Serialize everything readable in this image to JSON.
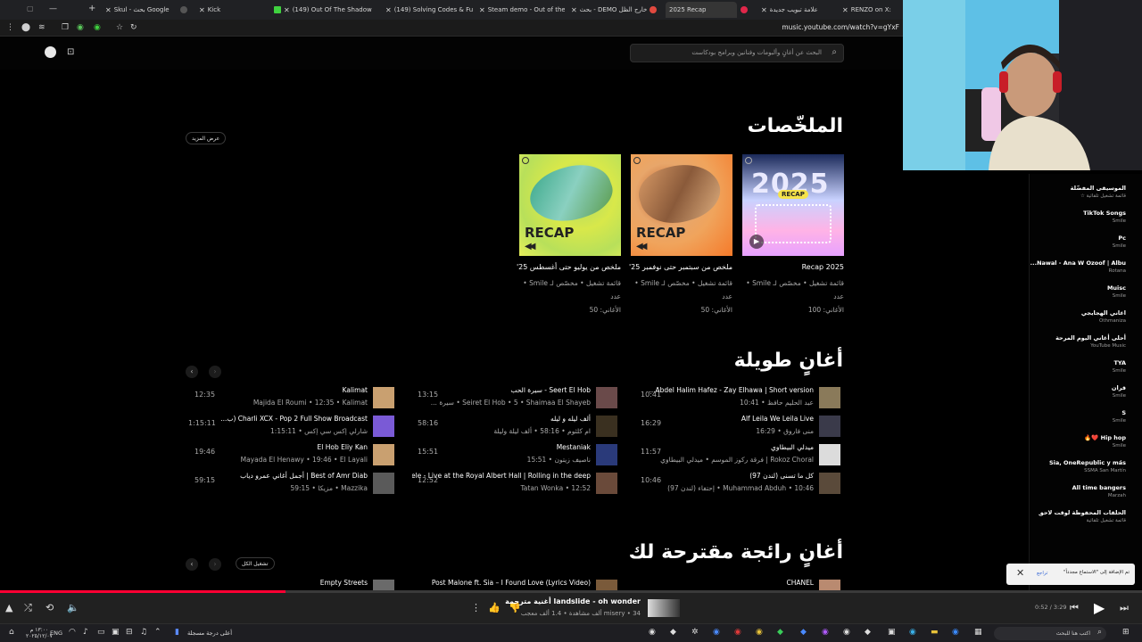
{
  "browser": {
    "tabs": [
      {
        "label": "Skul - بحث Google"
      },
      {
        "label": "Kick"
      },
      {
        "label": "(149) Out Of The Shadow"
      },
      {
        "label": "(149) Solving Codes & Fu"
      },
      {
        "label": "Steam demo - Out of the"
      },
      {
        "label": "بحث - DEMO خارج الظل"
      },
      {
        "label": "2025 Recap"
      },
      {
        "label": "علامة تبويب جديدة"
      },
      {
        "label": "RENZO on X: "
      }
    ],
    "url": "music.youtube.com/watch?v=gYxF"
  },
  "search": {
    "placeholder": "البحث عن أغانٍ وألبومات وفنانين وبرامج بودكاست"
  },
  "recap_section": {
    "heading": "الملخّصات",
    "more_label": "عرض المزيد",
    "cards": [
      {
        "title": "2025 Recap",
        "sub1": "قائمة تشغيل • مخصّص لـ Smile • عدد",
        "sub2": "الأغاني: 100",
        "badge": "2025",
        "badge2": "RECAP"
      },
      {
        "title": "ملخص من سبتمبر حتى نوفمبر 25'",
        "sub1": "قائمة تشغيل • مخصّص لـ Smile • عدد",
        "sub2": "الأغاني: 50",
        "word": "RECAP",
        "rewind": "◀◀"
      },
      {
        "title": "ملخص من يوليو حتى أغسطس 25'",
        "sub1": "قائمة تشغيل • مخصّص لـ Smile • عدد",
        "sub2": "الأغاني: 50",
        "word": "RECAP",
        "rewind": "◀◀"
      }
    ]
  },
  "long_section": {
    "heading": "أغانٍ طويلة",
    "songs": [
      {
        "title": "Abdel Halim Hafez - Zay Elhawa | Short version...",
        "sub": "عبد الحليم حافظ • 10:41",
        "dur": "10:41",
        "color": "#8a7a5a"
      },
      {
        "title": "Alf Leila We Leila Live",
        "sub": "منى فاروق • 16:29",
        "dur": "16:29",
        "color": "#3a3a4a"
      },
      {
        "title": "ميدلي البيطاوي",
        "sub": "Rokoz Choral | فرقة ركوز الموسم • ميدلي البيطاوي",
        "dur": "11:57",
        "color": "#dcdcdc"
      },
      {
        "title": "كل ما تسنى (لندن 97)",
        "sub": "Muhammad Abduh • 10:46 • إحتفاء (لندن 97)",
        "dur": "10:46",
        "color": "#5a4a3a"
      },
      {
        "title": "Seert El Hob - سيرة الحب",
        "sub": "Seiret El Hob • 5 • Shaimaa El Shayeb • سيرة ...",
        "dur": "13:15",
        "color": "#6a4a4a"
      },
      {
        "title": "ألف ليله و ليله",
        "sub": "ام كلثوم • 58:16 • ألف ليلة وليلة",
        "dur": "58:16",
        "color": "#3a3020"
      },
      {
        "title": "Mestaniak",
        "sub": "ناصيف زيتون • 15:51",
        "dur": "15:51",
        "color": "#2a3a7a"
      },
      {
        "title": "Adele - Live at the Royal Albert Hall | Rolling in the deep...",
        "sub": "Tatan Wonka • 12:52",
        "dur": "12:52",
        "color": "#6a4a3a"
      },
      {
        "title": "Kalimat",
        "sub": "Majida El Roumi • 12:35 • Kalimat",
        "dur": "12:35",
        "color": "#c9a070"
      },
      {
        "title": "Charli XCX - Pop 2 Full Show Broadcast (ب...",
        "sub": "شارلي إكس سي إكس • 1:15:11",
        "dur": "1:15:11",
        "color": "#7a5ad6"
      },
      {
        "title": "El Hob Eliy Kan",
        "sub": "Mayada El Henawy • 19:46 • El Layali",
        "dur": "19:46",
        "color": "#c9a070"
      },
      {
        "title": "Best of Amr Diab | أجمل أغاني عمرو دياب",
        "sub": "Mazzika • مزيكا • 59:15",
        "dur": "59:15",
        "color": "#5a5a5a"
      }
    ]
  },
  "trending_section": {
    "heading": "أغانٍ رائجة مقترحة لك",
    "play_all": "تشغيل الكل",
    "songs": [
      {
        "title": "CHANEL"
      },
      {
        "title": "Post Malone ft. Sia – I Found Love (Lyrics Video)"
      },
      {
        "title": "Empty Streets"
      }
    ]
  },
  "sidebar": {
    "items": [
      {
        "a": "الموسيقى المفضّلة",
        "b": "قائمة تشغيل تلقائية ☆"
      },
      {
        "a": "TikTok Songs",
        "b": "Smile"
      },
      {
        "a": "Pc",
        "b": "Smile"
      },
      {
        "a": "Nawal - Ana W Ozoof | Albu...",
        "b": "Rotana"
      },
      {
        "a": "Muisc",
        "b": "Smile"
      },
      {
        "a": "اغاني الهجايجي",
        "b": "Othmaniza"
      },
      {
        "a": "أحلى أغاني اليوم المرحة",
        "b": "YouTube Music"
      },
      {
        "a": "TYA",
        "b": "Smile"
      },
      {
        "a": "قران",
        "b": "Smile"
      },
      {
        "a": "S",
        "b": "Smile"
      },
      {
        "a": "Hip hop ❤️🔥",
        "b": "Smile"
      },
      {
        "a": "Sia, OneRepublic y más",
        "b": "SSMA San Martín"
      },
      {
        "a": "All time bangers",
        "b": "Marzah"
      },
      {
        "a": "الحلقات المحفوظة لوقت لاحق",
        "b": "قائمة تشغيل تلقائية"
      }
    ]
  },
  "toast": {
    "message": "تم الإضافة إلى \"الاستماع مجدداً\"",
    "undo": "تراجع"
  },
  "player": {
    "title": "landslide - oh wonder أغنية مترجمة",
    "sub": "misery • 34 ألف مشاهدة • 1.4 ألف معجب",
    "time": "0:52 / 3:29",
    "progress": 0.25
  },
  "taskbar": {
    "lang": "ENG",
    "clock_time": "١٣:٠٠ م",
    "clock_date": "٢٠٢٥/١٢/٠٧",
    "weather": "أعلى درجة مسجلة",
    "search_placeholder": "اكتب هنا للبحث"
  },
  "colors": {
    "accent": "#ff0033",
    "background": "#030303",
    "player_bg": "#212121"
  }
}
